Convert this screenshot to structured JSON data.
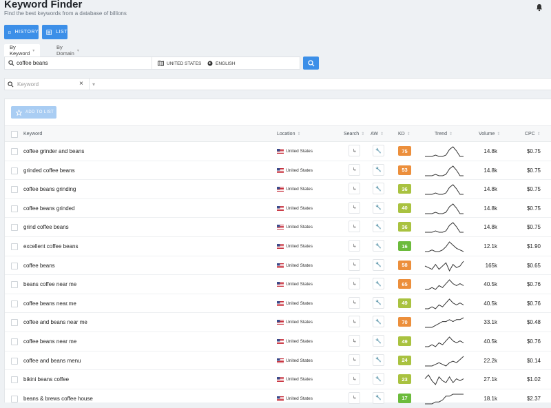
{
  "app": {
    "title": "Keyword Finder",
    "subtitle": "Find the best keywords from a database of billions"
  },
  "toolbar": {
    "history_label": "HISTORY",
    "list_label": "LIST"
  },
  "tabs": [
    {
      "label": "By Keyword"
    },
    {
      "label": "By Domain"
    }
  ],
  "search": {
    "keyword": "coffee beans",
    "location": "UNITED STATES",
    "language": "ENGLISH"
  },
  "filter": {
    "placeholder": "Keyword"
  },
  "actions": {
    "add_to_list": "ADD TO LIST"
  },
  "table": {
    "columns": {
      "keyword": "Keyword",
      "location": "Location",
      "search": "Search",
      "aw": "AW",
      "kd": "KD",
      "trend": "Trend",
      "volume": "Volume",
      "cpc": "CPC"
    },
    "rows": [
      {
        "keyword": "coffee grinder and beans",
        "location": "United States",
        "kd": 75,
        "volume": "14.8k",
        "cpc": "$0.75",
        "trend": [
          2,
          2,
          2,
          3,
          2,
          2,
          3,
          7,
          9,
          6,
          2,
          2
        ]
      },
      {
        "keyword": "grinded coffee beans",
        "location": "United States",
        "kd": 53,
        "volume": "14.8k",
        "cpc": "$0.75",
        "trend": [
          2,
          2,
          2,
          3,
          2,
          2,
          3,
          7,
          9,
          6,
          2,
          2
        ]
      },
      {
        "keyword": "coffee beans grinding",
        "location": "United States",
        "kd": 36,
        "volume": "14.8k",
        "cpc": "$0.75",
        "trend": [
          2,
          2,
          2,
          3,
          2,
          2,
          3,
          7,
          9,
          6,
          2,
          2
        ]
      },
      {
        "keyword": "coffee beans grinded",
        "location": "United States",
        "kd": 40,
        "volume": "14.8k",
        "cpc": "$0.75",
        "trend": [
          2,
          2,
          2,
          3,
          2,
          2,
          3,
          7,
          9,
          6,
          2,
          2
        ]
      },
      {
        "keyword": "grind coffee beans",
        "location": "United States",
        "kd": 36,
        "volume": "14.8k",
        "cpc": "$0.75",
        "trend": [
          2,
          2,
          2,
          3,
          2,
          2,
          3,
          7,
          9,
          6,
          2,
          2
        ]
      },
      {
        "keyword": "excellent coffee beans",
        "location": "United States",
        "kd": 16,
        "volume": "12.1k",
        "cpc": "$1.90",
        "trend": [
          2,
          2,
          3,
          2,
          2,
          3,
          5,
          8,
          6,
          4,
          3,
          2
        ]
      },
      {
        "keyword": "coffee beans",
        "location": "United States",
        "kd": 58,
        "volume": "165k",
        "cpc": "$0.65",
        "trend": [
          5,
          4,
          3,
          6,
          3,
          5,
          7,
          2,
          6,
          4,
          5,
          8
        ]
      },
      {
        "keyword": "beans coffee near me",
        "location": "United States",
        "kd": 65,
        "volume": "40.5k",
        "cpc": "$0.76",
        "trend": [
          2,
          2,
          3,
          2,
          4,
          3,
          5,
          7,
          5,
          4,
          5,
          4
        ]
      },
      {
        "keyword": "coffee beans near.me",
        "location": "United States",
        "kd": 49,
        "volume": "40.5k",
        "cpc": "$0.76",
        "trend": [
          2,
          2,
          3,
          2,
          4,
          3,
          5,
          7,
          5,
          4,
          5,
          4
        ]
      },
      {
        "keyword": "coffee and beans near me",
        "location": "United States",
        "kd": 70,
        "volume": "33.1k",
        "cpc": "$0.48",
        "trend": [
          3,
          3,
          3,
          4,
          5,
          6,
          6,
          7,
          6,
          7,
          7,
          8
        ]
      },
      {
        "keyword": "coffee beans near me",
        "location": "United States",
        "kd": 49,
        "volume": "40.5k",
        "cpc": "$0.76",
        "trend": [
          2,
          2,
          3,
          2,
          4,
          3,
          5,
          7,
          5,
          4,
          5,
          4
        ]
      },
      {
        "keyword": "coffee and beans menu",
        "location": "United States",
        "kd": 24,
        "volume": "22.2k",
        "cpc": "$0.14",
        "trend": [
          2,
          2,
          2,
          3,
          4,
          3,
          2,
          4,
          5,
          4,
          6,
          8
        ]
      },
      {
        "keyword": "bikini beans coffee",
        "location": "United States",
        "kd": 23,
        "volume": "27.1k",
        "cpc": "$1.02",
        "trend": [
          5,
          7,
          4,
          2,
          6,
          4,
          3,
          6,
          3,
          5,
          4,
          5
        ]
      },
      {
        "keyword": "beans & brews coffee house",
        "location": "United States",
        "kd": 17,
        "volume": "18.1k",
        "cpc": "$2.37",
        "trend": [
          2,
          2,
          2,
          3,
          3,
          4,
          6,
          6,
          7,
          7,
          7,
          7
        ]
      }
    ]
  },
  "colors": {
    "primary": "#3c8fe8",
    "kd_hard": "#ec8f3c",
    "kd_medium": "#a9c240",
    "kd_easy": "#6cbb3c"
  },
  "icons": {
    "bell": "bell-icon",
    "history": "calendar-icon",
    "list": "list-icon",
    "search": "search-icon",
    "globe": "globe-icon",
    "map": "map-icon",
    "star": "star-icon",
    "filter": "filter-icon",
    "close": "close-icon"
  }
}
